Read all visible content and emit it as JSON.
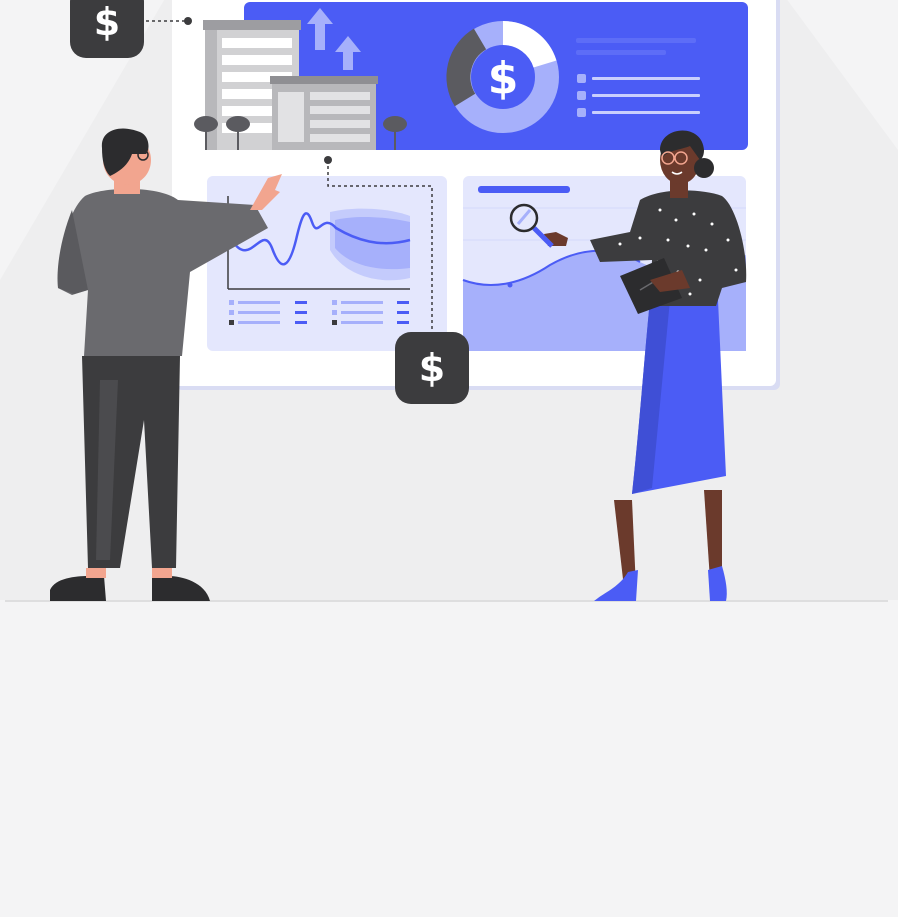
{
  "illustration": {
    "currency_symbol": "$",
    "palette": {
      "background": "#f4f4f5",
      "board": "#ffffff",
      "accent": "#4b5cf5",
      "accent_light": "#a6b0fb",
      "panel": "#e4e7fd",
      "dark": "#3c3c3e",
      "gray": "#6a6a6e",
      "skin_light": "#f2a58f",
      "skin_dark": "#6b3a2c"
    },
    "icons": [
      "dollar-badge-icon",
      "building-icon",
      "arrow-up-icon",
      "tree-icon",
      "donut-chart-icon",
      "line-chart-icon",
      "magnifier-icon",
      "clipboard-icon"
    ]
  }
}
